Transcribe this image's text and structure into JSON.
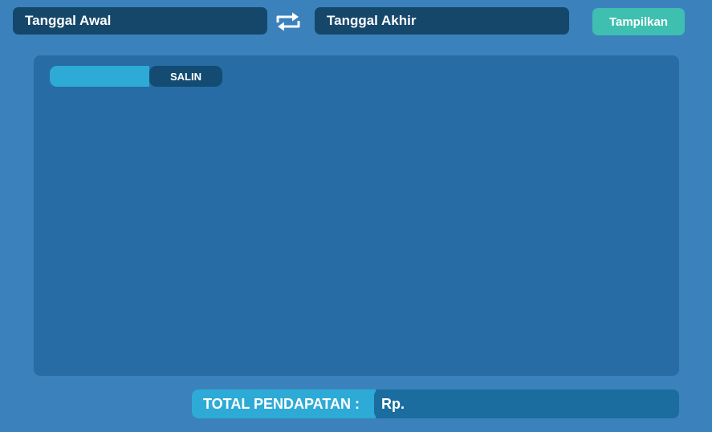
{
  "filter": {
    "start_date_placeholder": "Tanggal Awal",
    "end_date_placeholder": "Tanggal Akhir",
    "swap_icon": "swap-arrows-icon",
    "show_label": "Tampilkan"
  },
  "panel": {
    "copy_value": "",
    "copy_label": "SALIN"
  },
  "total": {
    "label": "TOTAL PENDAPATAN :",
    "value": "Rp."
  },
  "colors": {
    "background": "#3b82bd",
    "field": "#15476a",
    "accent_button": "#3ebfb0",
    "panel": "#286ca5",
    "light_blue": "#2eaad6",
    "total_value_bg": "#1a6d9e"
  }
}
